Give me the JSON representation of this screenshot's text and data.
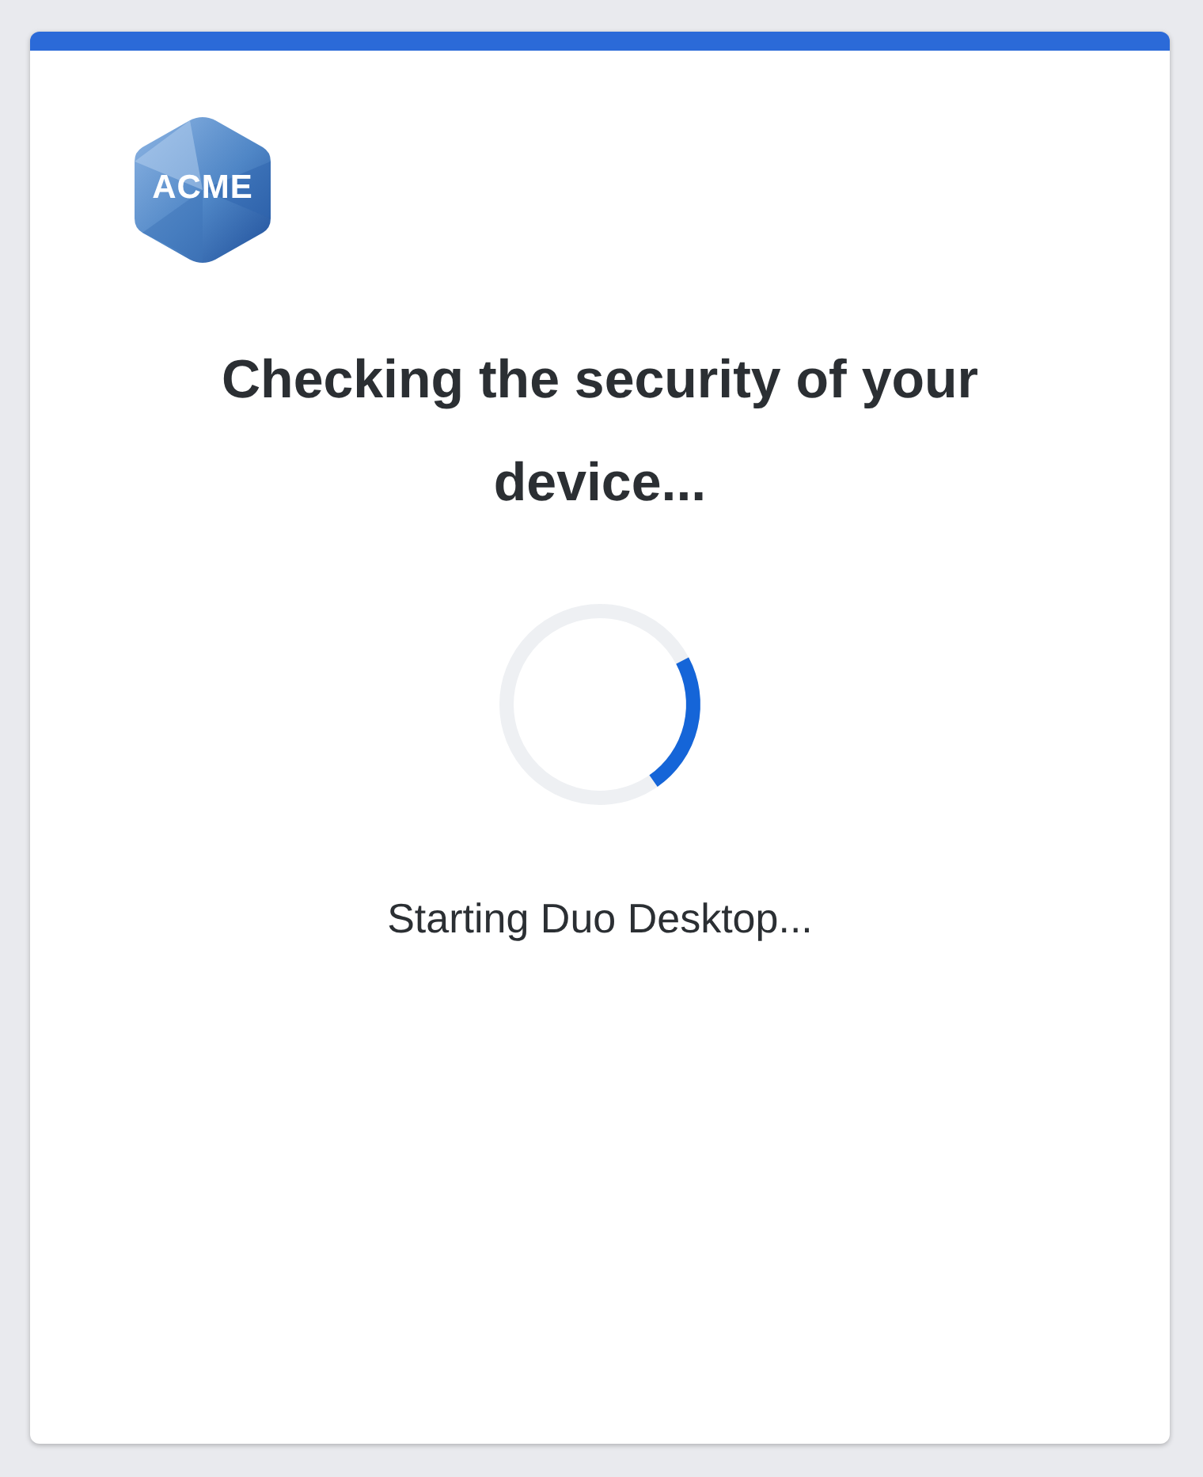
{
  "logo": {
    "text": "ACME"
  },
  "heading": "Checking the security of your device...",
  "status": "Starting Duo Desktop..."
}
